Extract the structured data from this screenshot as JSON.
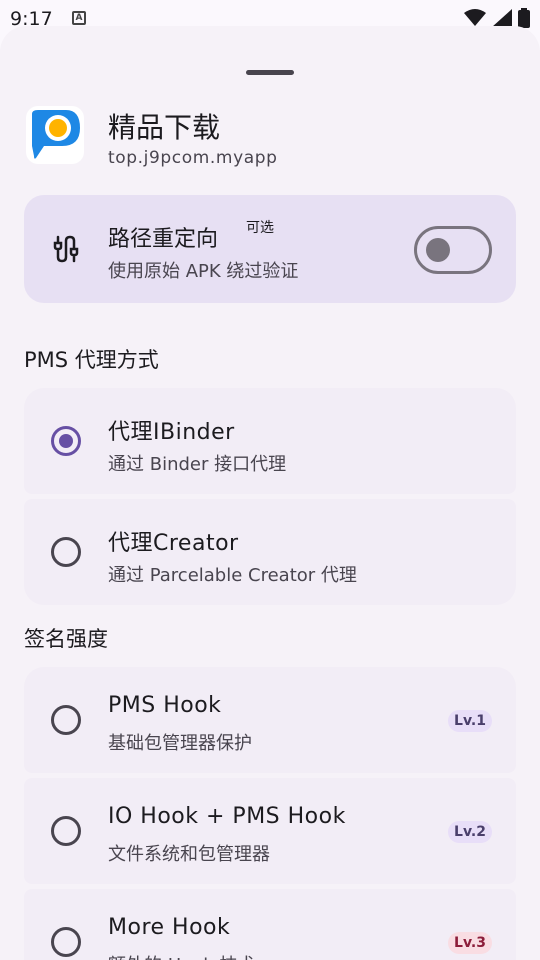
{
  "status_bar": {
    "time": "9:17",
    "notification_icon": "a-icon"
  },
  "app": {
    "name": "精品下载",
    "package": "top.j9pcom.myapp",
    "icon": "app-logo-icon"
  },
  "redirect": {
    "title": "路径重定向",
    "badge": "可选",
    "subtitle": "使用原始 APK 绕过验证",
    "enabled": false
  },
  "pms_section": {
    "title": "PMS 代理方式",
    "options": [
      {
        "title": "代理IBinder",
        "subtitle": "通过 Binder 接口代理",
        "selected": true
      },
      {
        "title": "代理Creator",
        "subtitle": "通过 Parcelable Creator 代理",
        "selected": false
      }
    ]
  },
  "signature_section": {
    "title": "签名强度",
    "options": [
      {
        "title": "PMS Hook",
        "subtitle": "基础包管理器保护",
        "level": "Lv.1",
        "selected": false
      },
      {
        "title": "IO Hook + PMS Hook",
        "subtitle": "文件系统和包管理器",
        "level": "Lv.2",
        "selected": false
      },
      {
        "title": "More Hook",
        "subtitle": "额外的 Hook 技术",
        "level": "Lv.3",
        "selected": false
      }
    ]
  },
  "colors": {
    "accent": "#6750a4",
    "card_highlight": "#e7e0f3",
    "level3_badge": "#f9dde3"
  }
}
